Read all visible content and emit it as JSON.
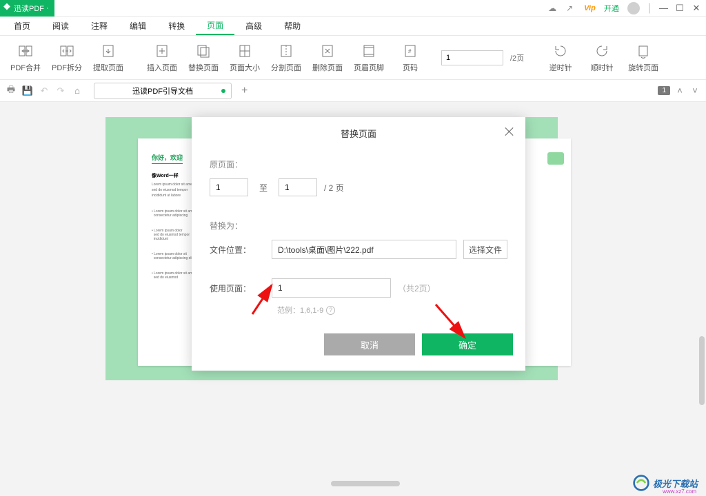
{
  "app": {
    "name": "迅读PDF"
  },
  "titlebar": {
    "vip_label": "开通"
  },
  "menu": {
    "items": [
      "首页",
      "阅读",
      "注释",
      "编辑",
      "转换",
      "页面",
      "高级",
      "帮助"
    ],
    "active_index": 5
  },
  "toolbar": {
    "items": [
      "PDF合并",
      "PDF拆分",
      "提取页面",
      "插入页面",
      "替换页面",
      "页面大小",
      "分割页面",
      "删除页面",
      "页眉页脚",
      "页码"
    ],
    "page_input": "1",
    "page_total": "/2页",
    "rotate": [
      "逆时针",
      "顺时针",
      "旋转页面"
    ]
  },
  "tabbar": {
    "doc_title": "迅读PDF引导文档",
    "page_badge": "1"
  },
  "doc_preview": {
    "heading": "你好，欢迎",
    "sub": "像Word一样"
  },
  "dialog": {
    "title": "替换页面",
    "section1_label": "原页面：",
    "from_value": "1",
    "to_label": "至",
    "to_value": "1",
    "total_label": "/ 2 页",
    "section2_label": "替换为：",
    "file_label": "文件位置：",
    "file_path": "D:\\tools\\桌面\\图片\\222.pdf",
    "browse_label": "选择文件",
    "use_pages_label": "使用页面：",
    "use_pages_value": "1",
    "use_pages_total": "（共2页）",
    "hint": "范例：1,6,1-9",
    "cancel": "取消",
    "ok": "确定"
  },
  "watermark": {
    "text": "极光下载站",
    "url": "www.xz7.com"
  }
}
